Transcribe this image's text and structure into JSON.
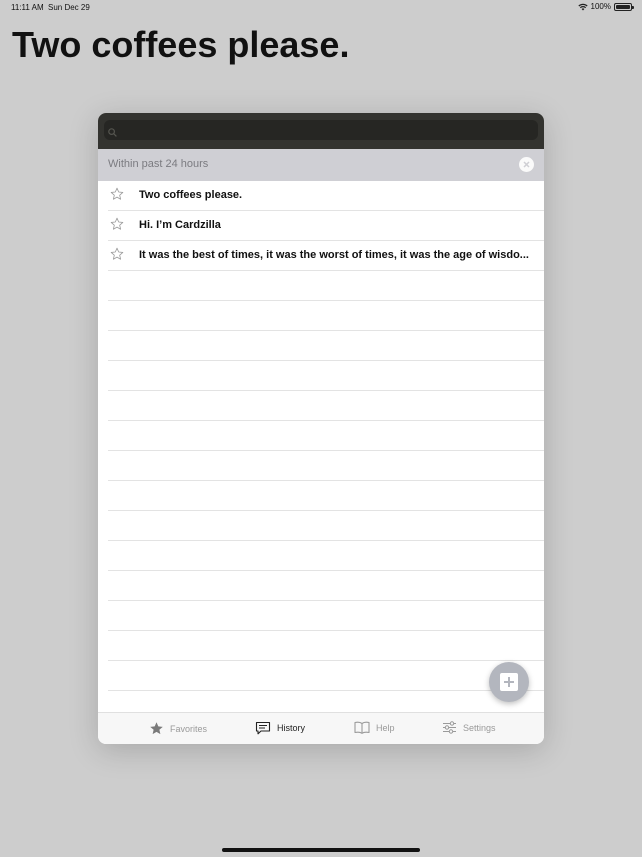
{
  "status": {
    "time": "11:11 AM",
    "date": "Sun Dec 29",
    "battery": "100%"
  },
  "page_title": "Two coffees please.",
  "search": {
    "placeholder": ""
  },
  "section": {
    "title": "Within past 24 hours"
  },
  "history": [
    {
      "text": "Two coffees please.",
      "favorite": false
    },
    {
      "text": "Hi. I’m Cardzilla",
      "favorite": false
    },
    {
      "text": "It was the best of times, it was the worst of times, it was the age of wisdo...",
      "favorite": false
    }
  ],
  "tabs": [
    {
      "label": "Favorites",
      "icon": "star-icon",
      "active": false
    },
    {
      "label": "History",
      "icon": "chat-bubble-icon",
      "active": true
    },
    {
      "label": "Help",
      "icon": "book-icon",
      "active": false
    },
    {
      "label": "Settings",
      "icon": "sliders-icon",
      "active": false
    }
  ],
  "colors": {
    "background": "#cdcdcd",
    "search_bar": "#33332f",
    "section_header": "#cfcfd4",
    "add_button": "#b3b6be"
  }
}
